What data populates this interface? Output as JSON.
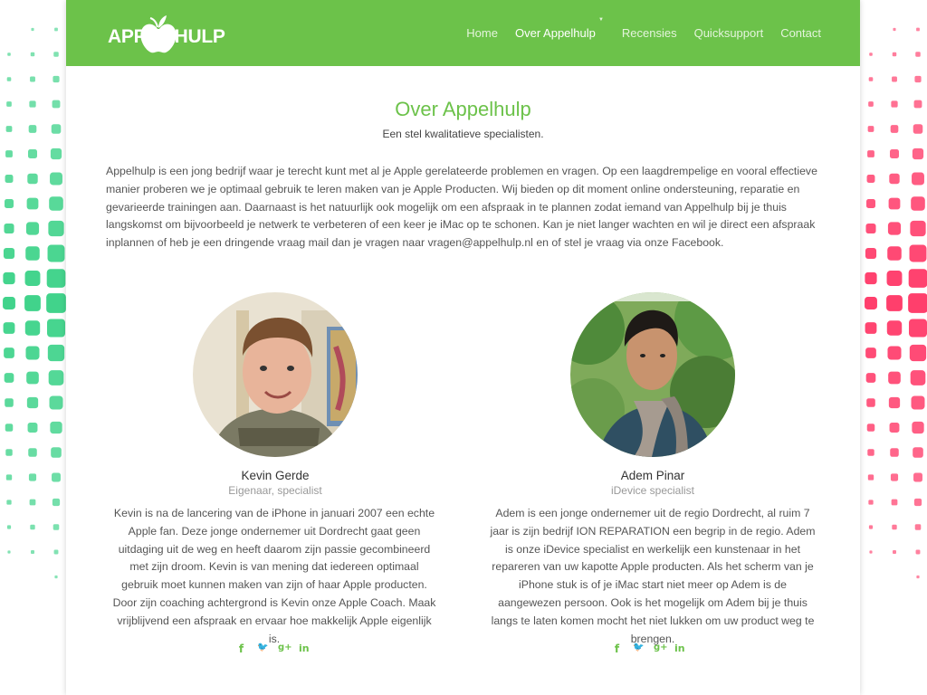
{
  "brand": {
    "logo_text": "APPEL HULP"
  },
  "nav": {
    "items": [
      {
        "label": "Home"
      },
      {
        "label": "Over Appelhulp"
      },
      {
        "label": "Recensies"
      },
      {
        "label": "Quicksupport"
      },
      {
        "label": "Contact"
      }
    ],
    "active_index": 1
  },
  "section": {
    "title": "Over Appelhulp",
    "subtitle": "Een stel kwalitatieve specialisten.",
    "intro": "Appelhulp is een jong bedrijf waar je terecht kunt met al je Apple gerelateerde problemen en vragen. Op een laagdrempelige en vooral effectieve manier proberen we je optimaal gebruik te leren maken van je Apple Producten. Wij bieden op dit moment online ondersteuning, reparatie en gevarieerde trainingen aan. Daarnaast is het natuurlijk ook mogelijk om een afspraak in te plannen zodat iemand van Appelhulp bij je thuis langskomst om bijvoorbeeld je netwerk te verbeteren of een keer je iMac op te schonen. Kan je niet langer wachten en wil je direct een afspraak inplannen of heb je een dringende vraag mail dan je vragen naar vragen@appelhulp.nl en of stel je vraag via onze Facebook."
  },
  "team": [
    {
      "name": "Kevin Gerde",
      "role": "Eigenaar, specialist",
      "bio": "Kevin is na de lancering van de iPhone in januari 2007 een echte Apple fan. Deze jonge ondernemer uit Dordrecht gaat geen uitdaging uit de weg en heeft daarom zijn passie gecombineerd met zijn droom. Kevin is van mening dat iedereen optimaal gebruik moet kunnen maken van zijn of haar Apple producten. Door zijn coaching achtergrond is Kevin onze Apple Coach. Maak vrijblijvend een afspraak en ervaar hoe makkelijk Apple eigenlijk is."
    },
    {
      "name": "Adem Pinar",
      "role": "iDevice specialist",
      "bio": "Adem is een jonge ondernemer uit de regio Dordrecht, al ruim 7 jaar is zijn bedrijf ION REPARATION  een begrip in de regio. Adem is onze iDevice specialist en werkelijk een kunstenaar in het repareren van uw kapotte Apple producten. Als het scherm van je iPhone stuk is of je iMac start niet meer op Adem is de aangewezen persoon. Ook is het mogelijk om Adem bij je thuis langs te laten komen mocht het niet lukken om uw product weg te brengen."
    }
  ],
  "social_glyphs": {
    "facebook": "f",
    "twitter": "🐦",
    "googleplus": "g+",
    "linkedin": "in"
  },
  "colors": {
    "brand_green": "#6cc24a",
    "bg_left_green": "#3fd38a",
    "bg_right_pink": "#ff3d6b"
  }
}
